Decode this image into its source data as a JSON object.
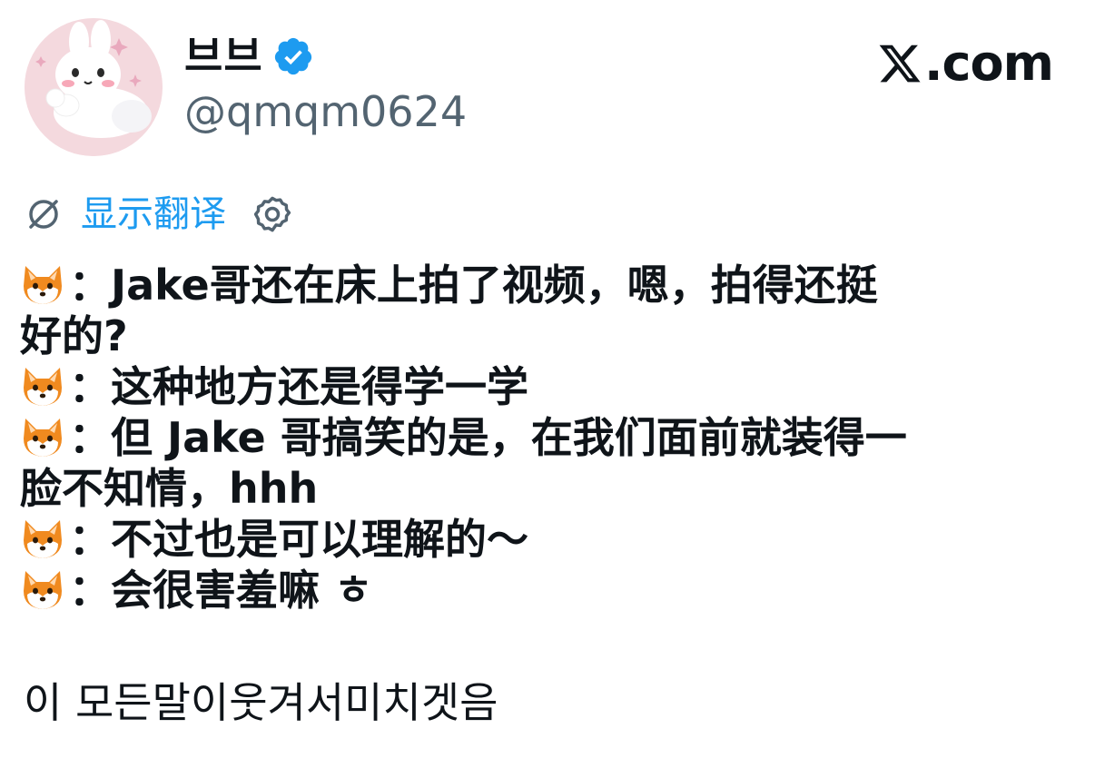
{
  "author": {
    "display_name": "브브",
    "handle": "@qmqm0624",
    "verified_icon": "verified-badge-icon",
    "verified_color": "#1d9bf0"
  },
  "brand": {
    "logo_icon": "x-logo-icon",
    "suffix": ".com"
  },
  "translation": {
    "icon": "translate-icon",
    "label": "显示翻译",
    "settings_icon": "gear-icon",
    "link_color": "#1d9bf0"
  },
  "tweet": {
    "lines": [
      {
        "prefix_icon": "fox-emoji-icon",
        "text": "：Jake哥还在床上拍了视频，嗯，拍得还挺"
      },
      {
        "prefix_icon": null,
        "text": "好的?"
      },
      {
        "prefix_icon": "fox-emoji-icon",
        "text": "：这种地方还是得学一学"
      },
      {
        "prefix_icon": "fox-emoji-icon",
        "text": "：但 Jake 哥搞笑的是，在我们面前就装得一"
      },
      {
        "prefix_icon": null,
        "text": "脸不知情，hhh"
      },
      {
        "prefix_icon": "fox-emoji-icon",
        "text": "：不过也是可以理解的～"
      },
      {
        "prefix_icon": "fox-emoji-icon",
        "text": "：会很害羞嘛 ㅎ"
      }
    ],
    "closing": "이 모든말이웃겨서미치겟음"
  }
}
